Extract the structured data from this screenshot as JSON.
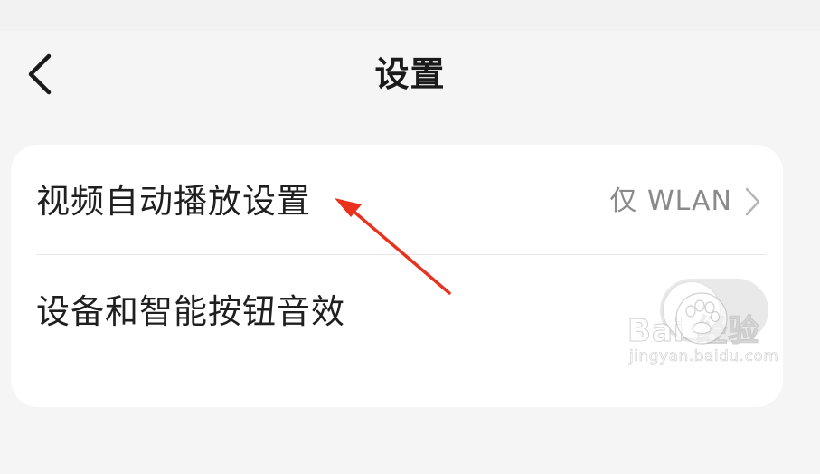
{
  "header": {
    "title": "设置",
    "back_icon": "chevron-left-icon"
  },
  "settings": {
    "items": [
      {
        "label": "视频自动播放设置",
        "value": "仅 WLAN",
        "icon": "chevron-right-icon"
      },
      {
        "label": "设备和智能按钮音效",
        "control": "toggle",
        "state": "off"
      },
      {
        "label": ""
      }
    ]
  },
  "colors": {
    "background": "#f5f5f5",
    "card": "#ffffff",
    "title_text": "#1a1a1a",
    "value_text": "#8a8a8a",
    "arrow": "#e8321e",
    "toggle_track": "#e9e9e9"
  },
  "watermark": {
    "brand": "Bai  经验",
    "url": "jingyan.baidu.com",
    "icon": "paw-icon"
  }
}
